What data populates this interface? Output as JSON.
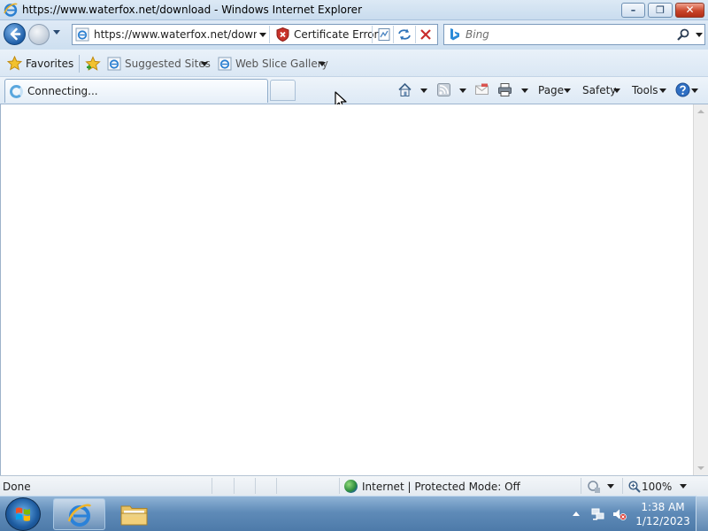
{
  "window": {
    "title": "https://www.waterfox.net/download - Windows Internet Explorer",
    "buttons": {
      "minimize": "–",
      "maximize": "❐",
      "close": "✕"
    }
  },
  "nav": {
    "url": "https://www.waterfox.net/download",
    "certificate_error": "Certificate Error",
    "search_placeholder": "Bing"
  },
  "favorites_bar": {
    "favorites_label": "Favorites",
    "links": [
      {
        "label": "Suggested Sites"
      },
      {
        "label": "Web Slice Gallery"
      }
    ]
  },
  "tab": {
    "title": "Connecting..."
  },
  "command_bar": {
    "page_label": "Page",
    "safety_label": "Safety",
    "tools_label": "Tools"
  },
  "status_bar": {
    "status": "Done",
    "zone": "Internet | Protected Mode: Off",
    "zoom": "100%"
  },
  "taskbar": {
    "time": "1:38 AM",
    "date": "1/12/2023"
  },
  "colors": {
    "titlebar": "#c9dcee",
    "taskbar": "#5f8bb8",
    "close_button": "#c9452a",
    "certificate_shield": "#c8322a"
  }
}
